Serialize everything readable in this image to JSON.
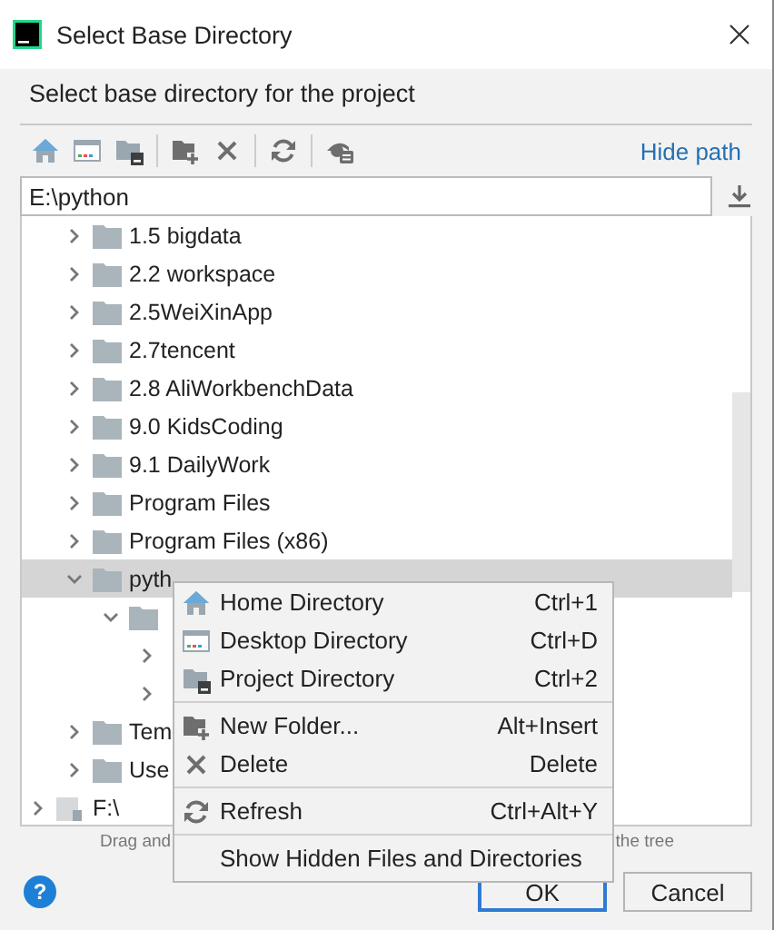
{
  "window": {
    "title": "Select Base Directory"
  },
  "prompt": "Select base directory for the project",
  "toolbar": {
    "link": "Hide path"
  },
  "path": {
    "value": "E:\\python"
  },
  "tree": {
    "items": [
      {
        "kind": "scrolled",
        "children": [
          {
            "kind": "folder",
            "label": "1.5 bigdata",
            "expanded": false,
            "selected": false
          },
          {
            "kind": "folder",
            "label": "2.2 workspace",
            "expanded": false,
            "selected": false
          },
          {
            "kind": "folder",
            "label": "2.5WeiXinApp",
            "expanded": false,
            "selected": false
          },
          {
            "kind": "folder",
            "label": "2.7tencent",
            "expanded": false,
            "selected": false
          },
          {
            "kind": "folder",
            "label": "2.8 AliWorkbenchData",
            "expanded": false,
            "selected": false
          },
          {
            "kind": "folder",
            "label": "9.0 KidsCoding",
            "expanded": false,
            "selected": false
          },
          {
            "kind": "folder",
            "label": "9.1 DailyWork",
            "expanded": false,
            "selected": false
          },
          {
            "kind": "folder",
            "label": "Program Files",
            "expanded": false,
            "selected": false
          },
          {
            "kind": "folder",
            "label": "Program Files (x86)",
            "expanded": false,
            "selected": false
          },
          {
            "kind": "folder",
            "label": "pyth",
            "expanded": true,
            "selected": true,
            "children": [
              {
                "kind": "folder",
                "expanded": true,
                "selected": false,
                "children": [
                  {
                    "kind": "covered",
                    "expanded": false,
                    "selected": false
                  },
                  {
                    "kind": "covered",
                    "expanded": false,
                    "selected": false
                  }
                ]
              }
            ]
          },
          {
            "kind": "folder",
            "label": "Tem",
            "expanded": false,
            "selected": false
          },
          {
            "kind": "folder",
            "label": "Use",
            "expanded": false,
            "selected": false
          }
        ]
      },
      {
        "kind": "drive",
        "label": "F:\\",
        "expanded": false,
        "selected": false
      }
    ]
  },
  "hint": [
    "Drag and",
    "the tree"
  ],
  "context_menu": [
    {
      "kind": "item",
      "label": "Home Directory",
      "shortcut": "Ctrl+1"
    },
    {
      "kind": "item",
      "label": "Desktop Directory",
      "shortcut": "Ctrl+D"
    },
    {
      "kind": "item",
      "label": "Project Directory",
      "shortcut": "Ctrl+2"
    },
    {
      "kind": "separator"
    },
    {
      "kind": "item",
      "label": "New Folder...",
      "shortcut": "Alt+Insert"
    },
    {
      "kind": "item",
      "label": "Delete",
      "shortcut": "Delete"
    },
    {
      "kind": "separator"
    },
    {
      "kind": "item",
      "label": "Refresh",
      "shortcut": "Ctrl+Alt+Y"
    },
    {
      "kind": "separator"
    },
    {
      "kind": "item",
      "label": "Show Hidden Files and Directories"
    }
  ],
  "buttons": [
    {
      "kind": "help",
      "label": "?"
    },
    {
      "kind": "default",
      "label": "OK"
    },
    {
      "kind": "normal",
      "label": "Cancel"
    }
  ]
}
